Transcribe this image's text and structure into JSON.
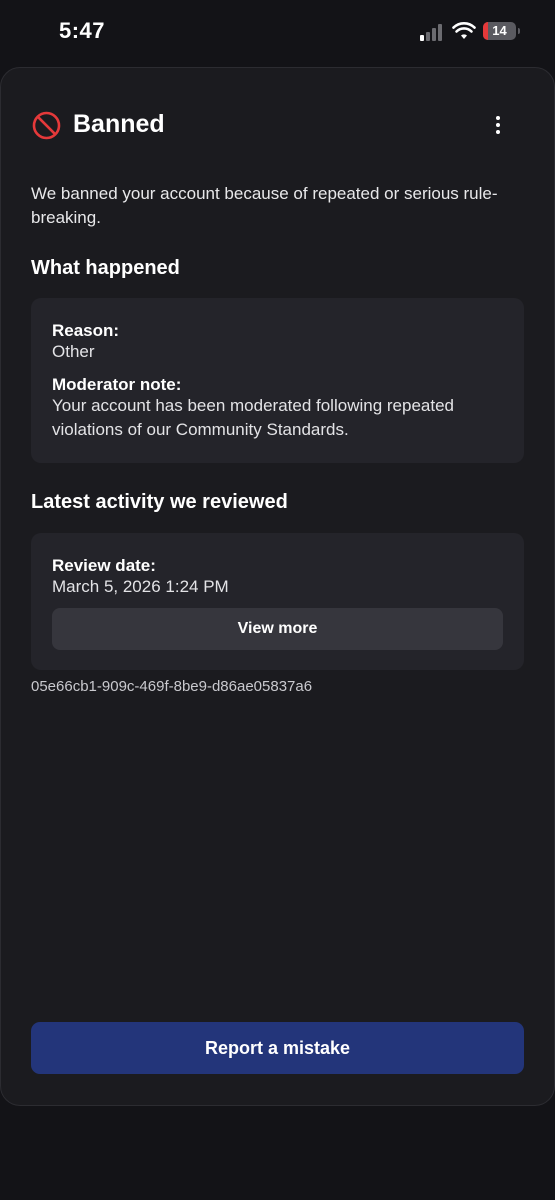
{
  "status_bar": {
    "time": "5:47",
    "battery_level": "14",
    "battery_fraction": 0.14,
    "signal_bars_active": 1,
    "signal_bars_total": 4,
    "icons": [
      "cellular-signal-icon",
      "wifi-icon",
      "battery-icon"
    ]
  },
  "header": {
    "title": "Banned",
    "status_icon": "prohibited-icon",
    "status_color": "#e5393a",
    "menu_icon": "more-vertical-icon"
  },
  "intro": "We banned your account because of repeated or serious rule-breaking.",
  "what_happened": {
    "title": "What happened",
    "reason_label": "Reason:",
    "reason_value": "Other",
    "note_label": "Moderator note:",
    "note_value": "Your account has been moderated following repeated violations of our Community Standards."
  },
  "latest_activity": {
    "title": "Latest activity we reviewed",
    "review_date_label": "Review date:",
    "review_date_value": "March 5, 2026 1:24 PM",
    "view_more_label": "View more"
  },
  "reference_id": "05e66cb1-909c-469f-8be9-d86ae05837a6",
  "report_button_label": "Report a mistake",
  "colors": {
    "background": "#131317",
    "sheet": "#1b1b1f",
    "card": "#24242a",
    "primary_button": "#23357a",
    "secondary_button": "#36363d"
  }
}
